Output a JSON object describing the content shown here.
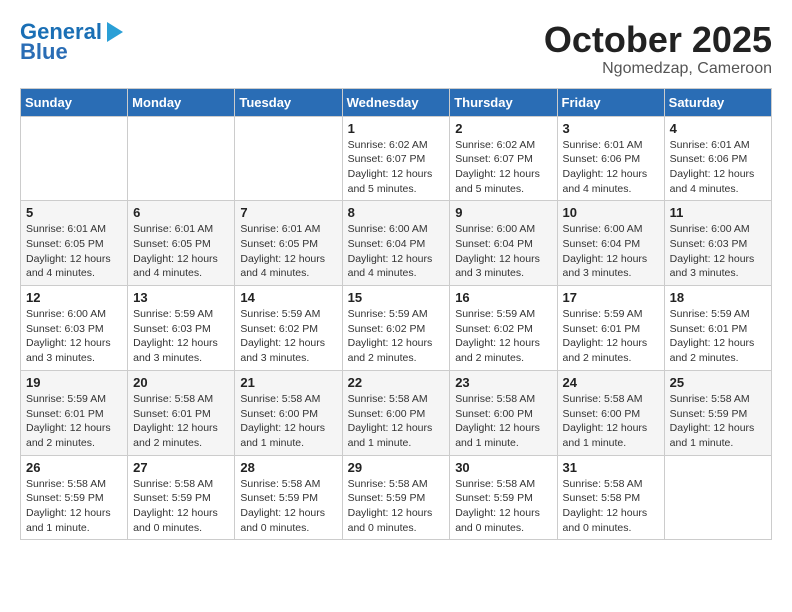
{
  "header": {
    "logo_line1": "General",
    "logo_line2": "Blue",
    "month": "October 2025",
    "location": "Ngomedzap, Cameroon"
  },
  "weekdays": [
    "Sunday",
    "Monday",
    "Tuesday",
    "Wednesday",
    "Thursday",
    "Friday",
    "Saturday"
  ],
  "weeks": [
    [
      {
        "day": "",
        "info": ""
      },
      {
        "day": "",
        "info": ""
      },
      {
        "day": "",
        "info": ""
      },
      {
        "day": "1",
        "info": "Sunrise: 6:02 AM\nSunset: 6:07 PM\nDaylight: 12 hours\nand 5 minutes."
      },
      {
        "day": "2",
        "info": "Sunrise: 6:02 AM\nSunset: 6:07 PM\nDaylight: 12 hours\nand 5 minutes."
      },
      {
        "day": "3",
        "info": "Sunrise: 6:01 AM\nSunset: 6:06 PM\nDaylight: 12 hours\nand 4 minutes."
      },
      {
        "day": "4",
        "info": "Sunrise: 6:01 AM\nSunset: 6:06 PM\nDaylight: 12 hours\nand 4 minutes."
      }
    ],
    [
      {
        "day": "5",
        "info": "Sunrise: 6:01 AM\nSunset: 6:05 PM\nDaylight: 12 hours\nand 4 minutes."
      },
      {
        "day": "6",
        "info": "Sunrise: 6:01 AM\nSunset: 6:05 PM\nDaylight: 12 hours\nand 4 minutes."
      },
      {
        "day": "7",
        "info": "Sunrise: 6:01 AM\nSunset: 6:05 PM\nDaylight: 12 hours\nand 4 minutes."
      },
      {
        "day": "8",
        "info": "Sunrise: 6:00 AM\nSunset: 6:04 PM\nDaylight: 12 hours\nand 4 minutes."
      },
      {
        "day": "9",
        "info": "Sunrise: 6:00 AM\nSunset: 6:04 PM\nDaylight: 12 hours\nand 3 minutes."
      },
      {
        "day": "10",
        "info": "Sunrise: 6:00 AM\nSunset: 6:04 PM\nDaylight: 12 hours\nand 3 minutes."
      },
      {
        "day": "11",
        "info": "Sunrise: 6:00 AM\nSunset: 6:03 PM\nDaylight: 12 hours\nand 3 minutes."
      }
    ],
    [
      {
        "day": "12",
        "info": "Sunrise: 6:00 AM\nSunset: 6:03 PM\nDaylight: 12 hours\nand 3 minutes."
      },
      {
        "day": "13",
        "info": "Sunrise: 5:59 AM\nSunset: 6:03 PM\nDaylight: 12 hours\nand 3 minutes."
      },
      {
        "day": "14",
        "info": "Sunrise: 5:59 AM\nSunset: 6:02 PM\nDaylight: 12 hours\nand 3 minutes."
      },
      {
        "day": "15",
        "info": "Sunrise: 5:59 AM\nSunset: 6:02 PM\nDaylight: 12 hours\nand 2 minutes."
      },
      {
        "day": "16",
        "info": "Sunrise: 5:59 AM\nSunset: 6:02 PM\nDaylight: 12 hours\nand 2 minutes."
      },
      {
        "day": "17",
        "info": "Sunrise: 5:59 AM\nSunset: 6:01 PM\nDaylight: 12 hours\nand 2 minutes."
      },
      {
        "day": "18",
        "info": "Sunrise: 5:59 AM\nSunset: 6:01 PM\nDaylight: 12 hours\nand 2 minutes."
      }
    ],
    [
      {
        "day": "19",
        "info": "Sunrise: 5:59 AM\nSunset: 6:01 PM\nDaylight: 12 hours\nand 2 minutes."
      },
      {
        "day": "20",
        "info": "Sunrise: 5:58 AM\nSunset: 6:01 PM\nDaylight: 12 hours\nand 2 minutes."
      },
      {
        "day": "21",
        "info": "Sunrise: 5:58 AM\nSunset: 6:00 PM\nDaylight: 12 hours\nand 1 minute."
      },
      {
        "day": "22",
        "info": "Sunrise: 5:58 AM\nSunset: 6:00 PM\nDaylight: 12 hours\nand 1 minute."
      },
      {
        "day": "23",
        "info": "Sunrise: 5:58 AM\nSunset: 6:00 PM\nDaylight: 12 hours\nand 1 minute."
      },
      {
        "day": "24",
        "info": "Sunrise: 5:58 AM\nSunset: 6:00 PM\nDaylight: 12 hours\nand 1 minute."
      },
      {
        "day": "25",
        "info": "Sunrise: 5:58 AM\nSunset: 5:59 PM\nDaylight: 12 hours\nand 1 minute."
      }
    ],
    [
      {
        "day": "26",
        "info": "Sunrise: 5:58 AM\nSunset: 5:59 PM\nDaylight: 12 hours\nand 1 minute."
      },
      {
        "day": "27",
        "info": "Sunrise: 5:58 AM\nSunset: 5:59 PM\nDaylight: 12 hours\nand 0 minutes."
      },
      {
        "day": "28",
        "info": "Sunrise: 5:58 AM\nSunset: 5:59 PM\nDaylight: 12 hours\nand 0 minutes."
      },
      {
        "day": "29",
        "info": "Sunrise: 5:58 AM\nSunset: 5:59 PM\nDaylight: 12 hours\nand 0 minutes."
      },
      {
        "day": "30",
        "info": "Sunrise: 5:58 AM\nSunset: 5:59 PM\nDaylight: 12 hours\nand 0 minutes."
      },
      {
        "day": "31",
        "info": "Sunrise: 5:58 AM\nSunset: 5:58 PM\nDaylight: 12 hours\nand 0 minutes."
      },
      {
        "day": "",
        "info": ""
      }
    ]
  ]
}
